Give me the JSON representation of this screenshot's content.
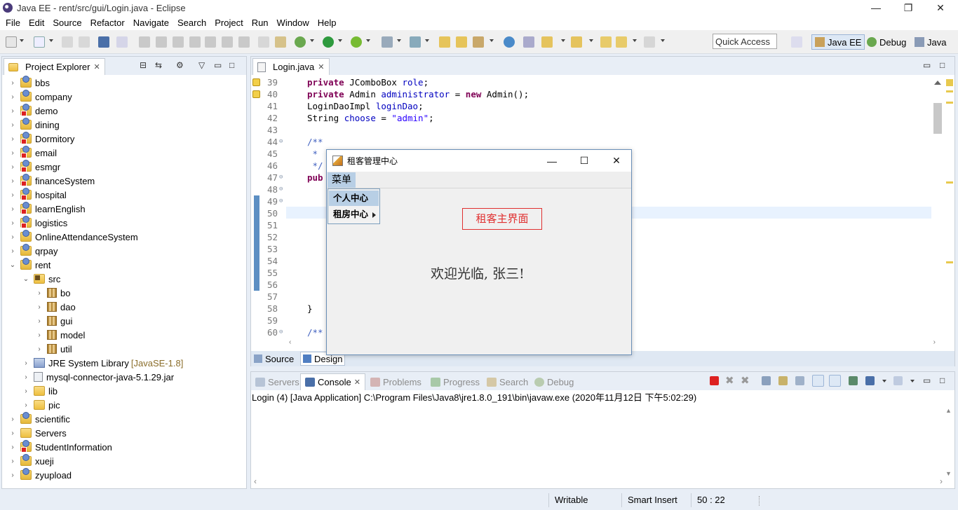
{
  "window": {
    "title": "Java EE - rent/src/gui/Login.java - Eclipse",
    "minimize": "—",
    "maximize": "❐",
    "close": "✕"
  },
  "menubar": [
    "File",
    "Edit",
    "Source",
    "Refactor",
    "Navigate",
    "Search",
    "Project",
    "Run",
    "Window",
    "Help"
  ],
  "toolbar": {
    "quick_access": "Quick Access",
    "perspectives": [
      {
        "label": "Java EE",
        "active": true
      },
      {
        "label": "Debug",
        "active": false
      },
      {
        "label": "Java",
        "active": false
      }
    ]
  },
  "project_explorer": {
    "tab_label": "Project Explorer",
    "items": [
      {
        "label": "bbs",
        "type": "proj",
        "depth": 0,
        "expanded": false
      },
      {
        "label": "company",
        "type": "proj",
        "depth": 0,
        "expanded": false
      },
      {
        "label": "demo",
        "type": "proj-err",
        "depth": 0,
        "expanded": false
      },
      {
        "label": "dining",
        "type": "proj",
        "depth": 0,
        "expanded": false
      },
      {
        "label": "Dormitory",
        "type": "proj-err",
        "depth": 0,
        "expanded": false
      },
      {
        "label": "email",
        "type": "proj-err",
        "depth": 0,
        "expanded": false
      },
      {
        "label": "esmgr",
        "type": "proj-err",
        "depth": 0,
        "expanded": false
      },
      {
        "label": "financeSystem",
        "type": "proj-err",
        "depth": 0,
        "expanded": false
      },
      {
        "label": "hospital",
        "type": "proj-err",
        "depth": 0,
        "expanded": false
      },
      {
        "label": "learnEnglish",
        "type": "proj-err",
        "depth": 0,
        "expanded": false
      },
      {
        "label": "logistics",
        "type": "proj-err",
        "depth": 0,
        "expanded": false
      },
      {
        "label": "OnlineAttendanceSystem",
        "type": "proj",
        "depth": 0,
        "expanded": false
      },
      {
        "label": "qrpay",
        "type": "proj",
        "depth": 0,
        "expanded": false
      },
      {
        "label": "rent",
        "type": "proj",
        "depth": 0,
        "expanded": true
      },
      {
        "label": "src",
        "type": "srcfolder",
        "depth": 1,
        "expanded": true
      },
      {
        "label": "bo",
        "type": "pkg",
        "depth": 2,
        "expanded": false
      },
      {
        "label": "dao",
        "type": "pkg",
        "depth": 2,
        "expanded": false
      },
      {
        "label": "gui",
        "type": "pkg",
        "depth": 2,
        "expanded": false
      },
      {
        "label": "model",
        "type": "pkg",
        "depth": 2,
        "expanded": false
      },
      {
        "label": "util",
        "type": "pkg",
        "depth": 2,
        "expanded": false
      },
      {
        "label": "JRE System Library",
        "suffix": "[JavaSE-1.8]",
        "type": "lib",
        "depth": 1,
        "expanded": false
      },
      {
        "label": "mysql-connector-java-5.1.29.jar",
        "type": "jar",
        "depth": 1,
        "expanded": false
      },
      {
        "label": "lib",
        "type": "folder",
        "depth": 1,
        "expanded": false
      },
      {
        "label": "pic",
        "type": "folder",
        "depth": 1,
        "expanded": false
      },
      {
        "label": "scientific",
        "type": "proj",
        "depth": 0,
        "expanded": false
      },
      {
        "label": "Servers",
        "type": "folder",
        "depth": 0,
        "expanded": false
      },
      {
        "label": "StudentInformation",
        "type": "proj-err",
        "depth": 0,
        "expanded": false
      },
      {
        "label": "xueji",
        "type": "proj",
        "depth": 0,
        "expanded": false
      },
      {
        "label": "zyupload",
        "type": "proj",
        "depth": 0,
        "expanded": false
      }
    ]
  },
  "editor": {
    "tab_label": "Login.java",
    "lines": [
      {
        "num": "39",
        "code": "private JComboBox role;",
        "warn": true
      },
      {
        "num": "40",
        "code": "private Admin administrator = new Admin();",
        "warn": true
      },
      {
        "num": "41",
        "code": "LoginDaoImpl loginDao;"
      },
      {
        "num": "42",
        "code": "String choose = \"admin\";"
      },
      {
        "num": "43",
        "code": ""
      },
      {
        "num": "44",
        "code": "/**",
        "fold": true
      },
      {
        "num": "45",
        "code": " *"
      },
      {
        "num": "46",
        "code": " */"
      },
      {
        "num": "47",
        "code": "pub",
        "fold": true
      },
      {
        "num": "48",
        "code": "",
        "fold": true
      },
      {
        "num": "49",
        "code": "",
        "fold": true
      },
      {
        "num": "50",
        "code": "",
        "current": true
      },
      {
        "num": "51",
        "code": ""
      },
      {
        "num": "52",
        "code": ""
      },
      {
        "num": "53",
        "code": ""
      },
      {
        "num": "54",
        "code": ""
      },
      {
        "num": "55",
        "code": ""
      },
      {
        "num": "56",
        "code": ""
      },
      {
        "num": "57",
        "code": ""
      },
      {
        "num": "58",
        "code": "}"
      },
      {
        "num": "59",
        "code": ""
      },
      {
        "num": "60",
        "code": "/**",
        "fold": true
      }
    ],
    "bottom_tabs": [
      "Source",
      "Design"
    ]
  },
  "console": {
    "tabs": [
      "Servers",
      "Console",
      "Problems",
      "Progress",
      "Search",
      "Debug"
    ],
    "active_tab": "Console",
    "header": "Login (4) [Java Application] C:\\Program Files\\Java8\\jre1.8.0_191\\bin\\javaw.exe (2020年11月12日 下午5:02:29)"
  },
  "status": {
    "writable": "Writable",
    "insert_mode": "Smart Insert",
    "position": "50 : 22"
  },
  "swing_window": {
    "title": "租客管理中心",
    "menu": "菜单",
    "popup_items": [
      "个人中心",
      "租房中心"
    ],
    "heading": "租客主界面",
    "welcome": "欢迎光临, 张三!"
  },
  "colors": {
    "accent": "#6a8fb8",
    "error_label": "#e03030",
    "menu_highlight": "#b8cfe5",
    "keyword": "#7f0055",
    "string": "#2a00ff",
    "field": "#0000c0"
  }
}
